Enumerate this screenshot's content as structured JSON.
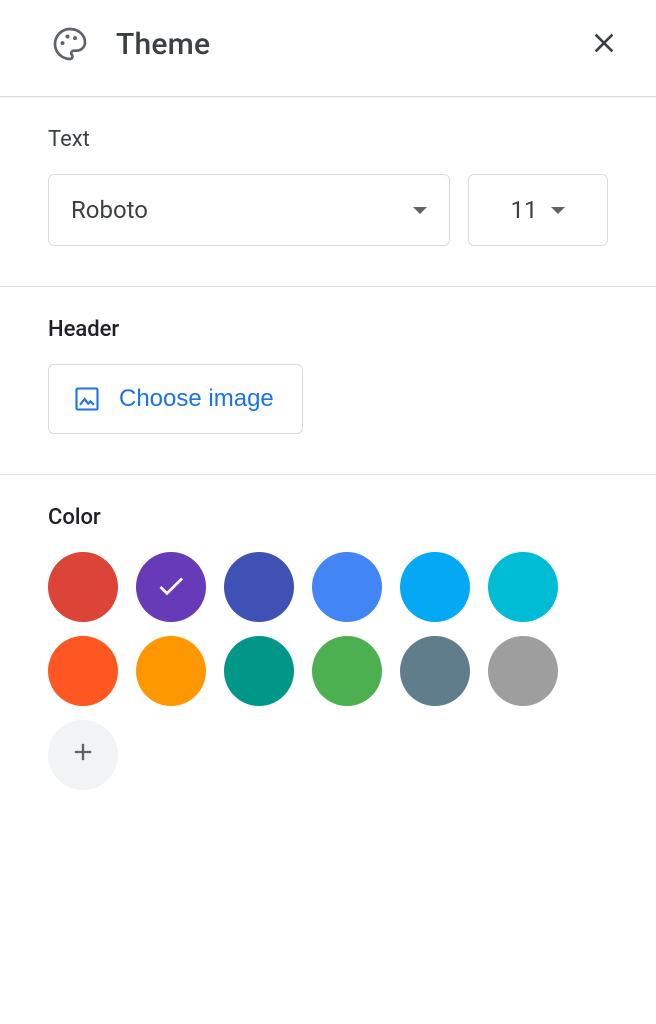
{
  "header": {
    "title": "Theme"
  },
  "text": {
    "label": "Text",
    "font": "Roboto",
    "size": "11"
  },
  "headerSection": {
    "label": "Header",
    "chooseImage": "Choose image"
  },
  "colorSection": {
    "label": "Color",
    "swatches": [
      {
        "hex": "#db4437",
        "selected": false
      },
      {
        "hex": "#673ab7",
        "selected": true
      },
      {
        "hex": "#3f51b5",
        "selected": false
      },
      {
        "hex": "#4285f4",
        "selected": false
      },
      {
        "hex": "#03a9f4",
        "selected": false
      },
      {
        "hex": "#00bcd4",
        "selected": false
      },
      {
        "hex": "#ff5722",
        "selected": false
      },
      {
        "hex": "#ff9800",
        "selected": false
      },
      {
        "hex": "#009688",
        "selected": false
      },
      {
        "hex": "#4caf50",
        "selected": false
      },
      {
        "hex": "#607d8b",
        "selected": false
      },
      {
        "hex": "#9e9e9e",
        "selected": false
      }
    ]
  }
}
